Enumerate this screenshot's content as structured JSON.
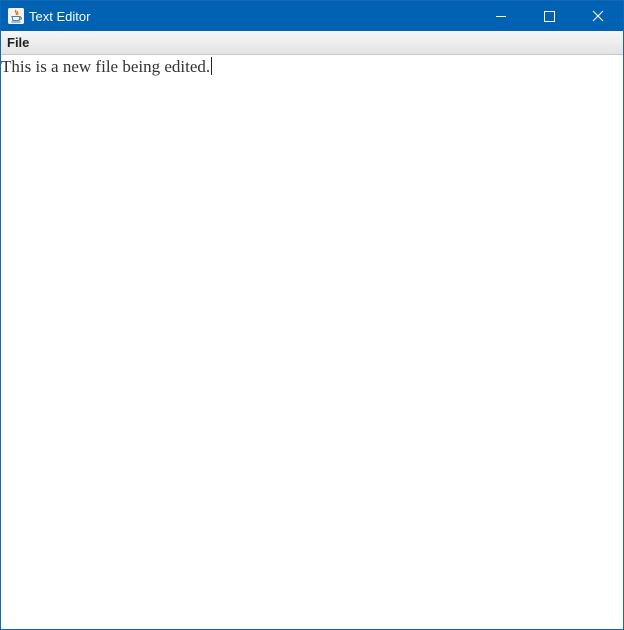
{
  "window": {
    "title": "Text Editor",
    "controls": {
      "minimize": "minimize-icon",
      "maximize": "maximize-icon",
      "close": "close-icon"
    },
    "colors": {
      "titlebar": "#0162b4",
      "border": "#1267b4",
      "title_text": "#ffffff"
    }
  },
  "menubar": {
    "items": [
      {
        "label": "File"
      }
    ]
  },
  "editor": {
    "content": "This is a new file being edited."
  },
  "icons": {
    "app": "java-cup-icon"
  }
}
